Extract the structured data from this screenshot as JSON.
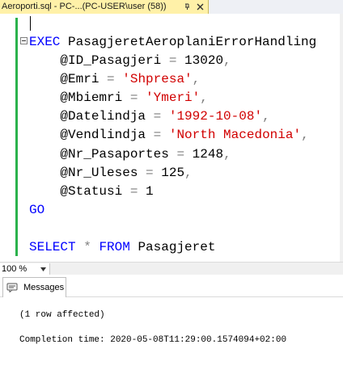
{
  "tab": {
    "title": "Aeroporti.sql - PC-...(PC-USER\\user (58))"
  },
  "editor": {
    "lines": [
      [
        {
          "t": "EXEC",
          "c": "kw"
        },
        {
          "t": " PasagjeretAeroplaniErrorHandling",
          "c": ""
        }
      ],
      [
        {
          "t": "    @ID_Pasagjeri ",
          "c": ""
        },
        {
          "t": "=",
          "c": "op"
        },
        {
          "t": " 13020",
          "c": ""
        },
        {
          "t": ",",
          "c": "op"
        }
      ],
      [
        {
          "t": "    @Emri ",
          "c": ""
        },
        {
          "t": "=",
          "c": "op"
        },
        {
          "t": " ",
          "c": ""
        },
        {
          "t": "'Shpresa'",
          "c": "str"
        },
        {
          "t": ",",
          "c": "op"
        }
      ],
      [
        {
          "t": "    @Mbiemri ",
          "c": ""
        },
        {
          "t": "=",
          "c": "op"
        },
        {
          "t": " ",
          "c": ""
        },
        {
          "t": "'Ymeri'",
          "c": "str"
        },
        {
          "t": ",",
          "c": "op"
        }
      ],
      [
        {
          "t": "    @Datelindja ",
          "c": ""
        },
        {
          "t": "=",
          "c": "op"
        },
        {
          "t": " ",
          "c": ""
        },
        {
          "t": "'1992-10-08'",
          "c": "str"
        },
        {
          "t": ",",
          "c": "op"
        }
      ],
      [
        {
          "t": "    @Vendlindja ",
          "c": ""
        },
        {
          "t": "=",
          "c": "op"
        },
        {
          "t": " ",
          "c": ""
        },
        {
          "t": "'North Macedonia'",
          "c": "str"
        },
        {
          "t": ",",
          "c": "op"
        }
      ],
      [
        {
          "t": "    @Nr_Pasaportes ",
          "c": ""
        },
        {
          "t": "=",
          "c": "op"
        },
        {
          "t": " 1248",
          "c": ""
        },
        {
          "t": ",",
          "c": "op"
        }
      ],
      [
        {
          "t": "    @Nr_Uleses ",
          "c": ""
        },
        {
          "t": "=",
          "c": "op"
        },
        {
          "t": " 125",
          "c": ""
        },
        {
          "t": ",",
          "c": "op"
        }
      ],
      [
        {
          "t": "    @Statusi ",
          "c": ""
        },
        {
          "t": "=",
          "c": "op"
        },
        {
          "t": " 1",
          "c": ""
        }
      ],
      [
        {
          "t": "GO",
          "c": "kw"
        }
      ],
      [
        {
          "t": "",
          "c": ""
        }
      ],
      [
        {
          "t": "SELECT",
          "c": "kw"
        },
        {
          "t": " ",
          "c": ""
        },
        {
          "t": "*",
          "c": "op"
        },
        {
          "t": " ",
          "c": ""
        },
        {
          "t": "FROM",
          "c": "kw"
        },
        {
          "t": " Pasagjeret",
          "c": ""
        }
      ]
    ]
  },
  "zoom": {
    "value": "100 %"
  },
  "results": {
    "tab_label": "Messages",
    "line1": "(1 row affected)",
    "line2": "Completion time: 2020-05-08T11:29:00.1574094+02:00"
  },
  "colors": {
    "keyword": "#0000ff",
    "string": "#d10000",
    "operator": "#7f7f7f",
    "margin_indicator": "#2bb24c",
    "tab_active": "#fff1a8"
  },
  "icons": {
    "tab_pin": "pin-icon",
    "tab_close": "close-icon",
    "collapse": "collapse-minus-icon",
    "zoom_dropdown": "chevron-down-icon",
    "messages": "messages-icon"
  }
}
